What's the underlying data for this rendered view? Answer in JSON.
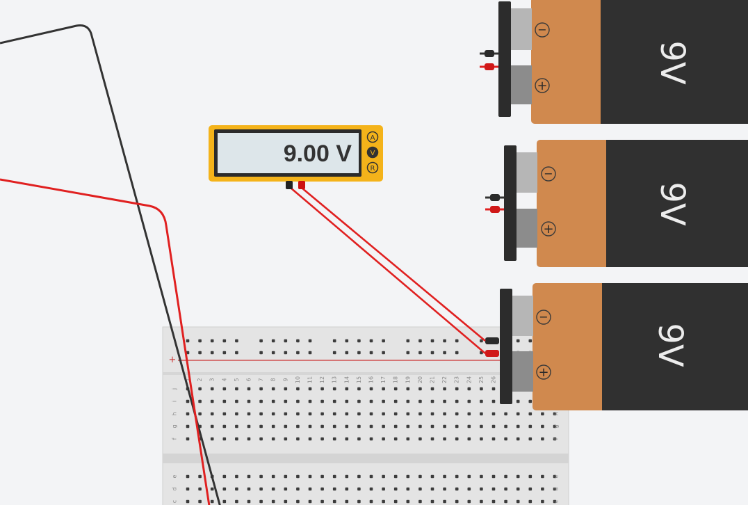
{
  "multimeter": {
    "reading": "9.00 V",
    "modes": [
      {
        "symbol": "A",
        "selected": false
      },
      {
        "symbol": "V",
        "selected": true
      },
      {
        "symbol": "R",
        "selected": false
      }
    ]
  },
  "batteries": [
    {
      "label": "9V",
      "minus_symbol": "−",
      "plus_symbol": "+"
    },
    {
      "label": "9V",
      "minus_symbol": "−",
      "plus_symbol": "+"
    },
    {
      "label": "9V",
      "minus_symbol": "−",
      "plus_symbol": "+"
    }
  ],
  "breadboard": {
    "power_rail_plus_symbol": "+",
    "column_numbers": [
      "1",
      "2",
      "3",
      "4",
      "5",
      "6",
      "7",
      "8",
      "9",
      "10",
      "11",
      "12",
      "13",
      "14",
      "15",
      "16",
      "17",
      "18",
      "19",
      "20",
      "21",
      "22",
      "23",
      "24",
      "25",
      "26"
    ],
    "top_row_letters": [
      "j",
      "i",
      "h",
      "g",
      "f"
    ],
    "bottom_row_letters": [
      "e",
      "d",
      "c"
    ]
  },
  "colors": {
    "background": "#f3f4f6",
    "wire_red": "#e02020",
    "wire_black": "#333333",
    "meter_body": "#f4b31a",
    "battery_orange": "#d0894e",
    "battery_dark": "#303030",
    "breadboard": "#e2e2e2"
  }
}
